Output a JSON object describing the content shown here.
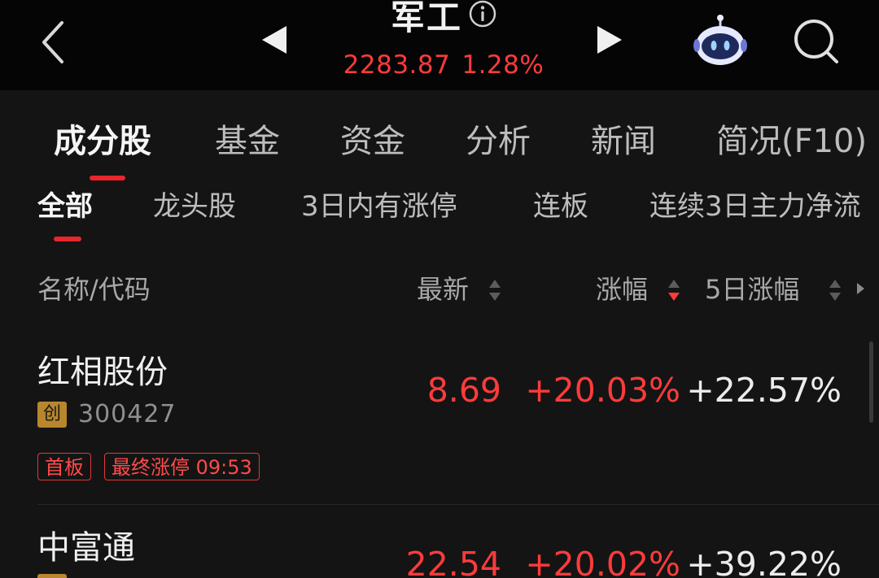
{
  "header": {
    "title": "军工",
    "index_value": "2283.87",
    "index_change": "1.28%"
  },
  "main_tabs": [
    {
      "label": "成分股",
      "active": true
    },
    {
      "label": "基金",
      "active": false
    },
    {
      "label": "资金",
      "active": false
    },
    {
      "label": "分析",
      "active": false
    },
    {
      "label": "新闻",
      "active": false
    },
    {
      "label": "简况(F10)",
      "active": false
    }
  ],
  "sub_tabs": [
    {
      "label": "全部",
      "active": true
    },
    {
      "label": "龙头股",
      "active": false
    },
    {
      "label": "3日内有涨停",
      "active": false
    },
    {
      "label": "连板",
      "active": false
    },
    {
      "label": "连续3日主力净流",
      "active": false
    }
  ],
  "columns": {
    "name": "名称/代码",
    "latest": "最新",
    "change": "涨幅",
    "five_day": "5日涨幅"
  },
  "rows": [
    {
      "name": "红相股份",
      "board": "创",
      "code": "300427",
      "latest": "8.69",
      "change": "+20.03%",
      "five_day": "+22.57%",
      "tags": [
        "首板",
        "最终涨停 09:53"
      ]
    },
    {
      "name": "中富通",
      "board": "",
      "code": "",
      "latest": "22.54",
      "change": "+20.02%",
      "five_day": "+39.22%",
      "tags": []
    }
  ],
  "colors": {
    "up": "#ff3b3b",
    "accent": "#e8262b",
    "board_badge": "#b8862d",
    "background": "#141414"
  },
  "icons": {
    "back": "chevron-left-icon",
    "prev": "triangle-left-icon",
    "next": "triangle-right-icon",
    "info": "info-icon",
    "assistant": "robot-assistant-icon",
    "search": "search-icon",
    "sort": "sort-arrows-icon"
  }
}
